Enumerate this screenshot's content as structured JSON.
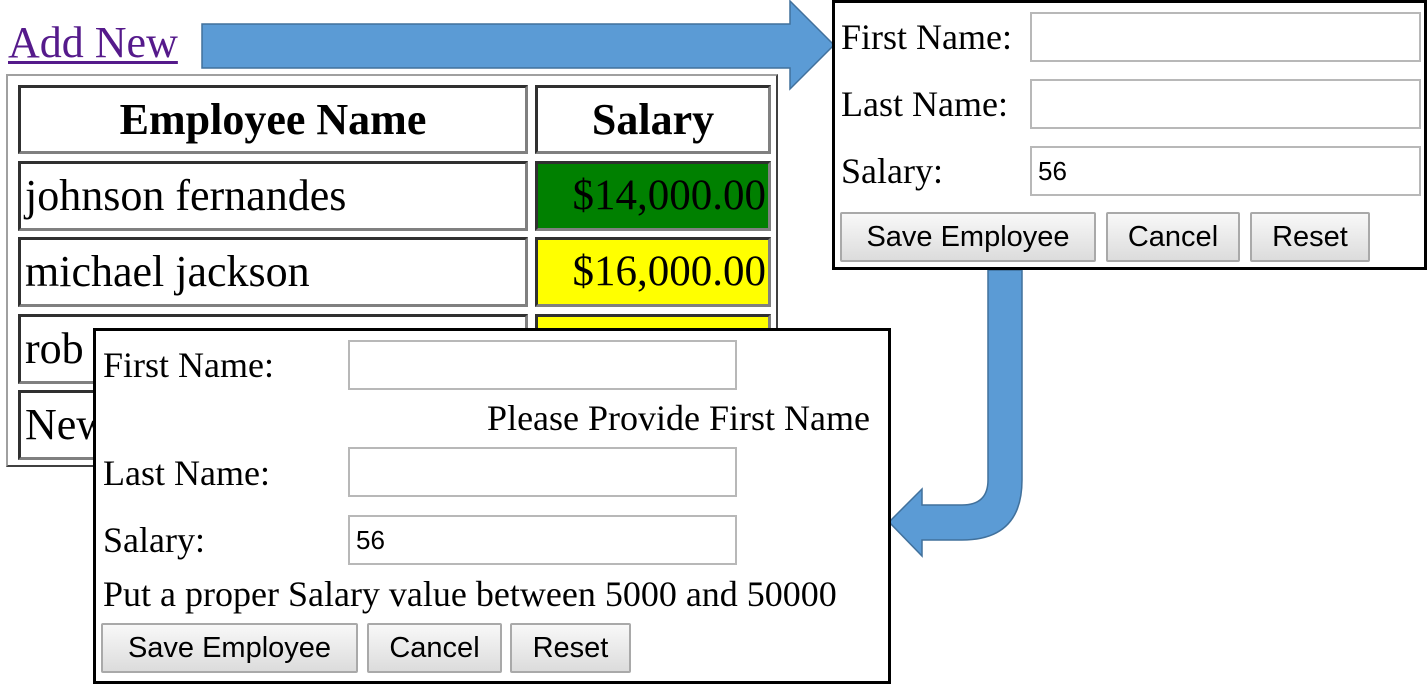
{
  "link": {
    "add_new": "Add New"
  },
  "table": {
    "headers": [
      "Employee Name",
      "Salary"
    ],
    "rows": [
      {
        "name": "johnson fernandes",
        "salary": "$14,000.00",
        "salary_bg": "#008000"
      },
      {
        "name": "michael jackson",
        "salary": "$16,000.00",
        "salary_bg": "#ffff00"
      },
      {
        "name": "rob",
        "salary": "",
        "salary_bg": "#ffff00"
      },
      {
        "name": "New",
        "salary": "",
        "salary_bg": "#ffffff"
      }
    ]
  },
  "form_initial": {
    "first_name_label": "First Name:",
    "first_name_value": "",
    "last_name_label": "Last Name:",
    "last_name_value": "",
    "salary_label": "Salary:",
    "salary_value": "56",
    "buttons": {
      "save": "Save Employee",
      "cancel": "Cancel",
      "reset": "Reset"
    }
  },
  "form_validation": {
    "first_name_label": "First Name:",
    "first_name_value": "",
    "first_name_error": "Please Provide First Name",
    "last_name_label": "Last Name:",
    "last_name_value": "",
    "salary_label": "Salary:",
    "salary_value": "56",
    "salary_error": "Put a proper Salary value between 5000 and 50000",
    "buttons": {
      "save": "Save Employee",
      "cancel": "Cancel",
      "reset": "Reset"
    }
  },
  "colors": {
    "arrow_fill": "#5b9bd5",
    "arrow_stroke": "#41719c",
    "link": "#551a8b"
  }
}
